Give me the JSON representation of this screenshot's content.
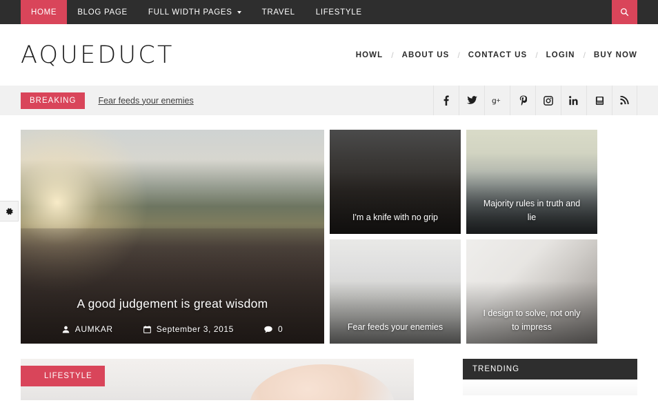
{
  "theme": {
    "accent": "#d9455a",
    "dark": "#2e2e2e",
    "bar_bg": "#f1f1f1"
  },
  "topnav": {
    "items": [
      {
        "label": "HOME",
        "active": true,
        "caret": false
      },
      {
        "label": "BLOG PAGE",
        "active": false,
        "caret": false
      },
      {
        "label": "FULL WIDTH PAGES",
        "active": false,
        "caret": true
      },
      {
        "label": "TRAVEL",
        "active": false,
        "caret": false
      },
      {
        "label": "LIFESTYLE",
        "active": false,
        "caret": false
      }
    ],
    "search_icon": "search-icon"
  },
  "header": {
    "logo": "AQUEDUCT",
    "links": [
      "HOWL",
      "ABOUT US",
      "CONTACT US",
      "LOGIN",
      "BUY NOW"
    ],
    "separator": "/"
  },
  "breaking": {
    "badge": "BREAKING",
    "headline": "Fear feeds your enemies",
    "socials": [
      "facebook-icon",
      "twitter-icon",
      "google-plus-icon",
      "pinterest-icon",
      "instagram-icon",
      "linkedin-icon",
      "youtube-icon",
      "rss-icon"
    ]
  },
  "sidetab": {
    "icon": "gear-icon"
  },
  "featured": {
    "hero": {
      "title": "A good judgement is great wisdom",
      "author": "AUMKAR",
      "date": "September 3, 2015",
      "comments": "0",
      "author_icon": "user-icon",
      "date_icon": "calendar-icon",
      "comment_icon": "comment-icon"
    },
    "tiles": [
      {
        "title": "I'm a knife with no grip"
      },
      {
        "title": "Majority rules in truth and lie"
      },
      {
        "title": "Fear feeds your enemies"
      },
      {
        "title": "I design to solve, not only to impress"
      }
    ]
  },
  "sections": {
    "lifestyle_label": "LIFESTYLE",
    "trending_label": "TRENDING"
  }
}
